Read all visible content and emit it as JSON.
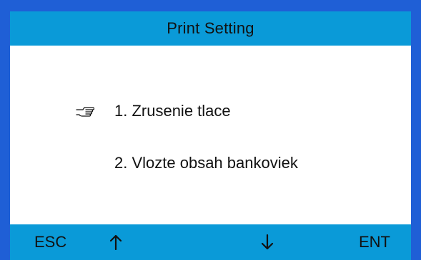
{
  "header": {
    "title": "Print Setting"
  },
  "menu": {
    "items": [
      {
        "label": "1.  Zrusenie tlace",
        "selected": true,
        "pointer_icon": "hand-pointing-icon"
      },
      {
        "label": "2.  Vlozte obsah bankoviek",
        "selected": false
      }
    ]
  },
  "footer": {
    "esc_label": "ESC",
    "ent_label": "ENT",
    "up_icon": "arrow-up-icon",
    "down_icon": "arrow-down-icon"
  },
  "colors": {
    "frame": "#1f5fd6",
    "bars": "#0a9ad8",
    "content_bg": "#ffffff",
    "text": "#111111"
  }
}
